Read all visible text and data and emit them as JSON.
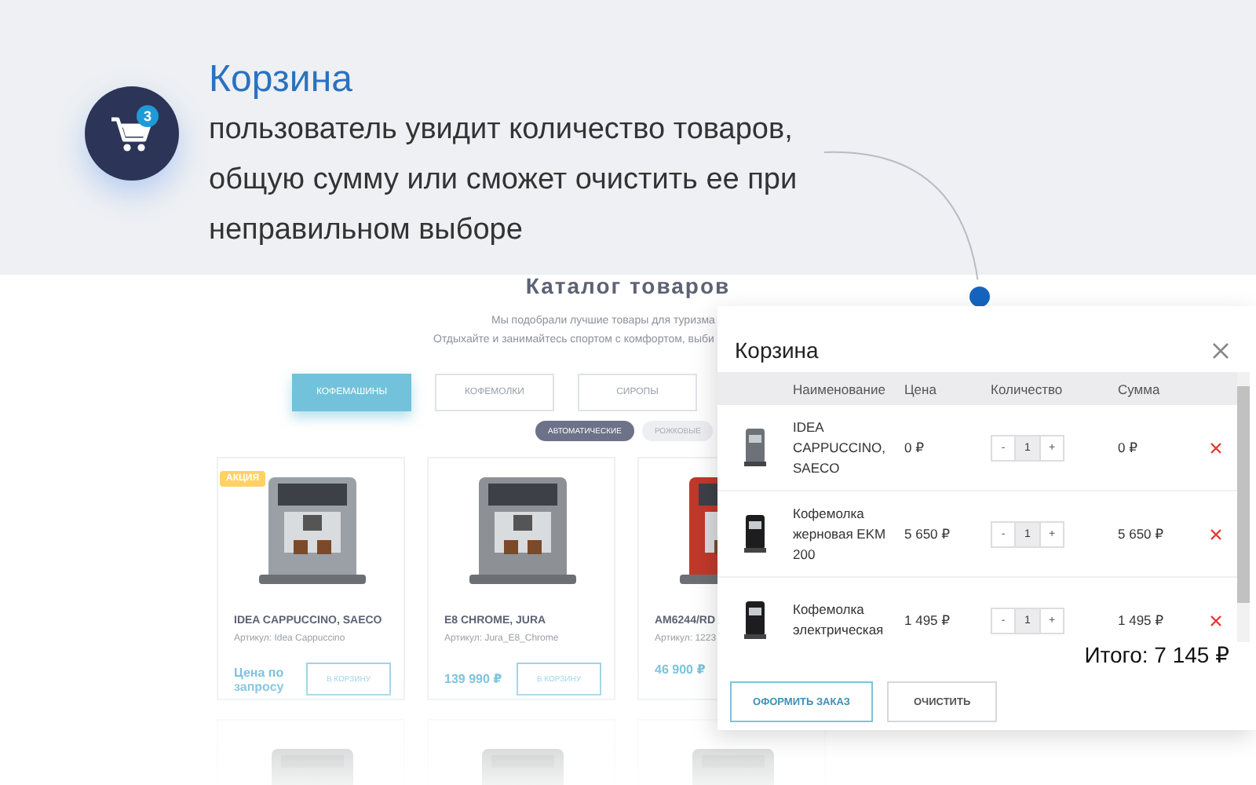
{
  "callout": {
    "badge": "3",
    "title": "Корзина",
    "text": "пользователь увидит количество товаров, общую сумму или сможет очистить ее при неправильном выборе"
  },
  "catalog": {
    "title": "Каталог товаров",
    "subtitle_lines": [
      "Мы подобрали лучшие товары для туризма",
      "Отдыхайте и занимайтесь спортом с комфортом, выби"
    ],
    "tabs": [
      {
        "label": "КОФЕМАШИНЫ",
        "selected": true
      },
      {
        "label": "КОФЕМОЛКИ",
        "selected": false
      },
      {
        "label": "СИРОПЫ",
        "selected": false
      }
    ],
    "subtabs": [
      {
        "label": "АВТОМАТИЧЕСКИЕ",
        "selected": true
      },
      {
        "label": "РОЖКОВЫЕ",
        "selected": false
      }
    ],
    "products": [
      {
        "badge": "АКЦИЯ",
        "name": "IDEA CAPPUCCINO, SAECO",
        "article": "Артикул: Idea Cappuccino",
        "price": "Цена по запросу",
        "button": "В КОРЗИНУ",
        "color": "#9aa0a6"
      },
      {
        "name": "E8 CHROME, JURA",
        "article": "Артикул: Jura_E8_Chrome",
        "price": "139 990 ₽",
        "button": "В КОРЗИНУ",
        "color": "#8d9196"
      },
      {
        "name": "AM6244/RD",
        "article": "Артикул: 1223",
        "price": "46 900 ₽",
        "color": "#c0392b"
      }
    ]
  },
  "cart": {
    "title": "Корзина",
    "columns": [
      "Наименование",
      "Цена",
      "Количество",
      "Сумма"
    ],
    "rows": [
      {
        "name": "IDEA CAPPUCCINO, SAECO",
        "price": "0 ₽",
        "minus": "-",
        "quantity": "1",
        "plus": "+",
        "sum": "0 ₽"
      },
      {
        "name": "Кофемолка жерновая EKM 200",
        "price": "5 650 ₽",
        "minus": "-",
        "quantity": "1",
        "plus": "+",
        "sum": "5 650 ₽"
      },
      {
        "name": "Кофемолка электрическая",
        "price": "1 495 ₽",
        "minus": "-",
        "quantity": "1",
        "plus": "+",
        "sum": "1 495 ₽"
      }
    ],
    "total": "Итого: 7 145 ₽",
    "buttons": [
      {
        "label": "ОФОРМИТЬ ЗАКАЗ",
        "kind": "primary"
      },
      {
        "label": "ОЧИСТИТЬ",
        "kind": "secondary"
      }
    ]
  }
}
